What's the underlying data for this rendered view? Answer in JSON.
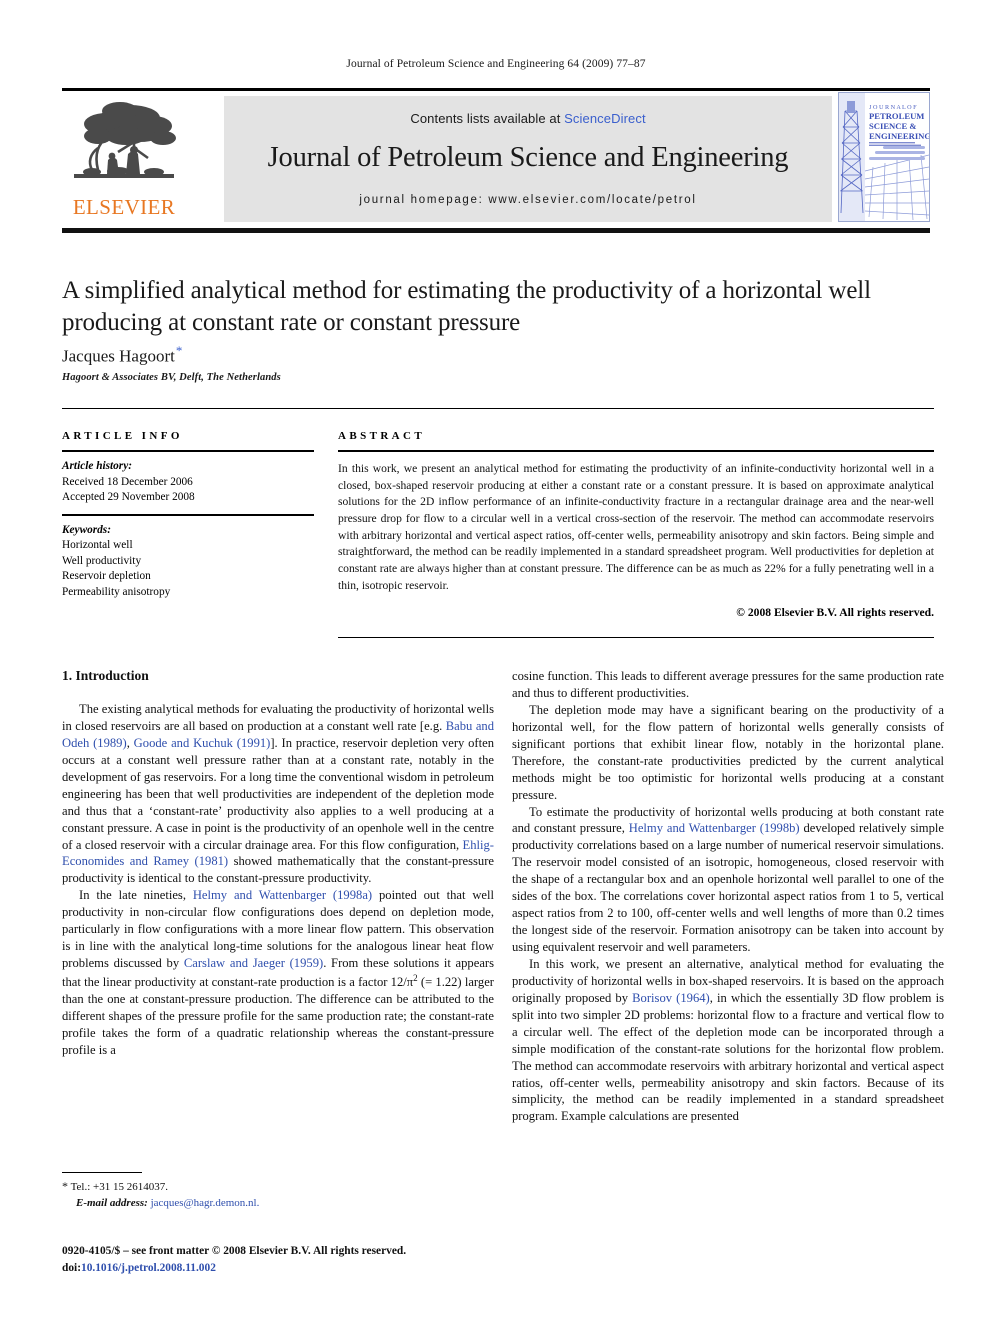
{
  "running_head": "Journal of Petroleum Science and Engineering 64 (2009) 77–87",
  "masthead": {
    "contents_prefix": "Contents lists available at ",
    "sciencedirect": "ScienceDirect",
    "journal_title": "Journal of Petroleum Science and Engineering",
    "homepage": "journal homepage: www.elsevier.com/locate/petrol",
    "publisher_wordmark": "ELSEVIER",
    "cover_lines": [
      "JOURNAL OF",
      "PETROLEUM",
      "SCIENCE &",
      "ENGINEERING"
    ],
    "colors": {
      "link": "#3a5fcd",
      "elsevier_orange": "#E87722",
      "banner_bg": "#e3e3e3",
      "cover_blue": "#4b5fc0"
    }
  },
  "article": {
    "title": "A simplified analytical method for estimating the productivity of a horizontal well producing at constant rate or constant pressure",
    "author": "Jacques Hagoort",
    "author_marker": "*",
    "affiliation": "Hagoort & Associates BV, Delft, The Netherlands"
  },
  "article_info": {
    "label": "ARTICLE INFO",
    "history_heading": "Article history:",
    "history": [
      "Received 18 December 2006",
      "Accepted 29 November 2008"
    ],
    "keywords_heading": "Keywords:",
    "keywords": [
      "Horizontal well",
      "Well productivity",
      "Reservoir depletion",
      "Permeability anisotropy"
    ]
  },
  "abstract": {
    "label": "ABSTRACT",
    "text": "In this work, we present an analytical method for estimating the productivity of an infinite-conductivity horizontal well in a closed, box-shaped reservoir producing at either a constant rate or a constant pressure. It is based on approximate analytical solutions for the 2D inflow performance of an infinite-conductivity fracture in a rectangular drainage area and the near-well pressure drop for flow to a circular well in a vertical cross-section of the reservoir. The method can accommodate reservoirs with arbitrary horizontal and vertical aspect ratios, off-center wells, permeability anisotropy and skin factors. Being simple and straightforward, the method can be readily implemented in a standard spreadsheet program. Well productivities for depletion at constant rate are always higher than at constant pressure. The difference can be as much as 22% for a fully penetrating well in a thin, isotropic reservoir.",
    "copyright": "© 2008 Elsevier B.V. All rights reserved."
  },
  "body": {
    "section_title": "1. Introduction",
    "left_paragraphs": [
      {
        "segments": [
          {
            "t": "The existing analytical methods for evaluating the productivity of horizontal wells in closed reservoirs are all based on production at a constant well rate [e.g. ",
            "ref": false
          },
          {
            "t": "Babu and Odeh (1989)",
            "ref": true
          },
          {
            "t": ", ",
            "ref": false
          },
          {
            "t": "Goode and Kuchuk (1991)",
            "ref": true
          },
          {
            "t": "]. In practice, reservoir depletion very often occurs at a constant well pressure rather than at a constant rate, notably in the development of gas reservoirs. For a long time the conventional wisdom in petroleum engineering has been that well productivities are independent of the depletion mode and thus that a ‘constant-rate’ productivity also applies to a well producing at a constant pressure. A case in point is the productivity of an openhole well in the centre of a closed reservoir with a circular drainage area. For this flow configuration, ",
            "ref": false
          },
          {
            "t": "Ehlig-Economides and Ramey (1981)",
            "ref": true
          },
          {
            "t": " showed mathematically that the constant-pressure productivity is identical to the constant-pressure productivity.",
            "ref": false
          }
        ]
      },
      {
        "segments": [
          {
            "t": "In the late nineties, ",
            "ref": false
          },
          {
            "t": "Helmy and Wattenbarger (1998a)",
            "ref": true
          },
          {
            "t": " pointed out that well productivity in non-circular flow configurations does depend on depletion mode, particularly in flow configurations with a more linear flow pattern. This observation is in line with the analytical long-time solutions for the analogous linear heat flow problems discussed by ",
            "ref": false
          },
          {
            "t": "Carslaw and Jaeger (1959)",
            "ref": true
          },
          {
            "t": ". From these solutions it appears that the linear productivity at constant-rate production is a factor 12/π",
            "ref": false
          },
          {
            "t": "2",
            "sup": true
          },
          {
            "t": " (= 1.22) larger than the one at constant-pressure production. The difference can be attributed to the different shapes of the pressure profile for the same production rate; the constant-rate profile takes the form of a quadratic relationship whereas the constant-pressure profile is a",
            "ref": false
          }
        ]
      }
    ],
    "right_paragraphs": [
      {
        "noindent": true,
        "segments": [
          {
            "t": "cosine function. This leads to different average pressures for the same production rate and thus to different productivities.",
            "ref": false
          }
        ]
      },
      {
        "segments": [
          {
            "t": "The depletion mode may have a significant bearing on the productivity of a horizontal well, for the flow pattern of horizontal wells generally consists of significant portions that exhibit linear flow, notably in the horizontal plane. Therefore, the constant-rate productivities predicted by the current analytical methods might be too optimistic for horizontal wells producing at a constant pressure.",
            "ref": false
          }
        ]
      },
      {
        "segments": [
          {
            "t": "To estimate the productivity of horizontal wells producing at both constant rate and constant pressure, ",
            "ref": false
          },
          {
            "t": "Helmy and Wattenbarger (1998b)",
            "ref": true
          },
          {
            "t": " developed relatively simple productivity correlations based on a large number of numerical reservoir simulations. The reservoir model consisted of an isotropic, homogeneous, closed reservoir with the shape of a rectangular box and an openhole horizontal well parallel to one of the sides of the box. The correlations cover horizontal aspect ratios from 1 to 5, vertical aspect ratios from 2 to 100, off-center wells and well lengths of more than 0.2 times the longest side of the reservoir. Formation anisotropy can be taken into account by using equivalent reservoir and well parameters.",
            "ref": false
          }
        ]
      },
      {
        "segments": [
          {
            "t": "In this work, we present an alternative, analytical method for evaluating the productivity of horizontal wells in box-shaped reservoirs. It is based on the approach originally proposed by ",
            "ref": false
          },
          {
            "t": "Borisov (1964)",
            "ref": true
          },
          {
            "t": ", in which the essentially 3D flow problem is split into two simpler 2D problems: horizontal flow to a fracture and vertical flow to a circular well. The effect of the depletion mode can be incorporated through a simple modification of the constant-rate solutions for the horizontal flow problem. The method can accommodate reservoirs with arbitrary horizontal and vertical aspect ratios, off-center wells, permeability anisotropy and skin factors. Because of its simplicity, the method can be readily implemented in a standard spreadsheet program. Example calculations are presented",
            "ref": false
          }
        ]
      }
    ]
  },
  "footnote": {
    "marker": "*",
    "tel": "Tel.: +31 15 2614037.",
    "email_label": "E-mail address:",
    "email": "jacques@hagr.demon.nl."
  },
  "footer": {
    "line1": "0920-4105/$ – see front matter © 2008 Elsevier B.V. All rights reserved.",
    "doi_label": "doi:",
    "doi": "10.1016/j.petrol.2008.11.002"
  }
}
